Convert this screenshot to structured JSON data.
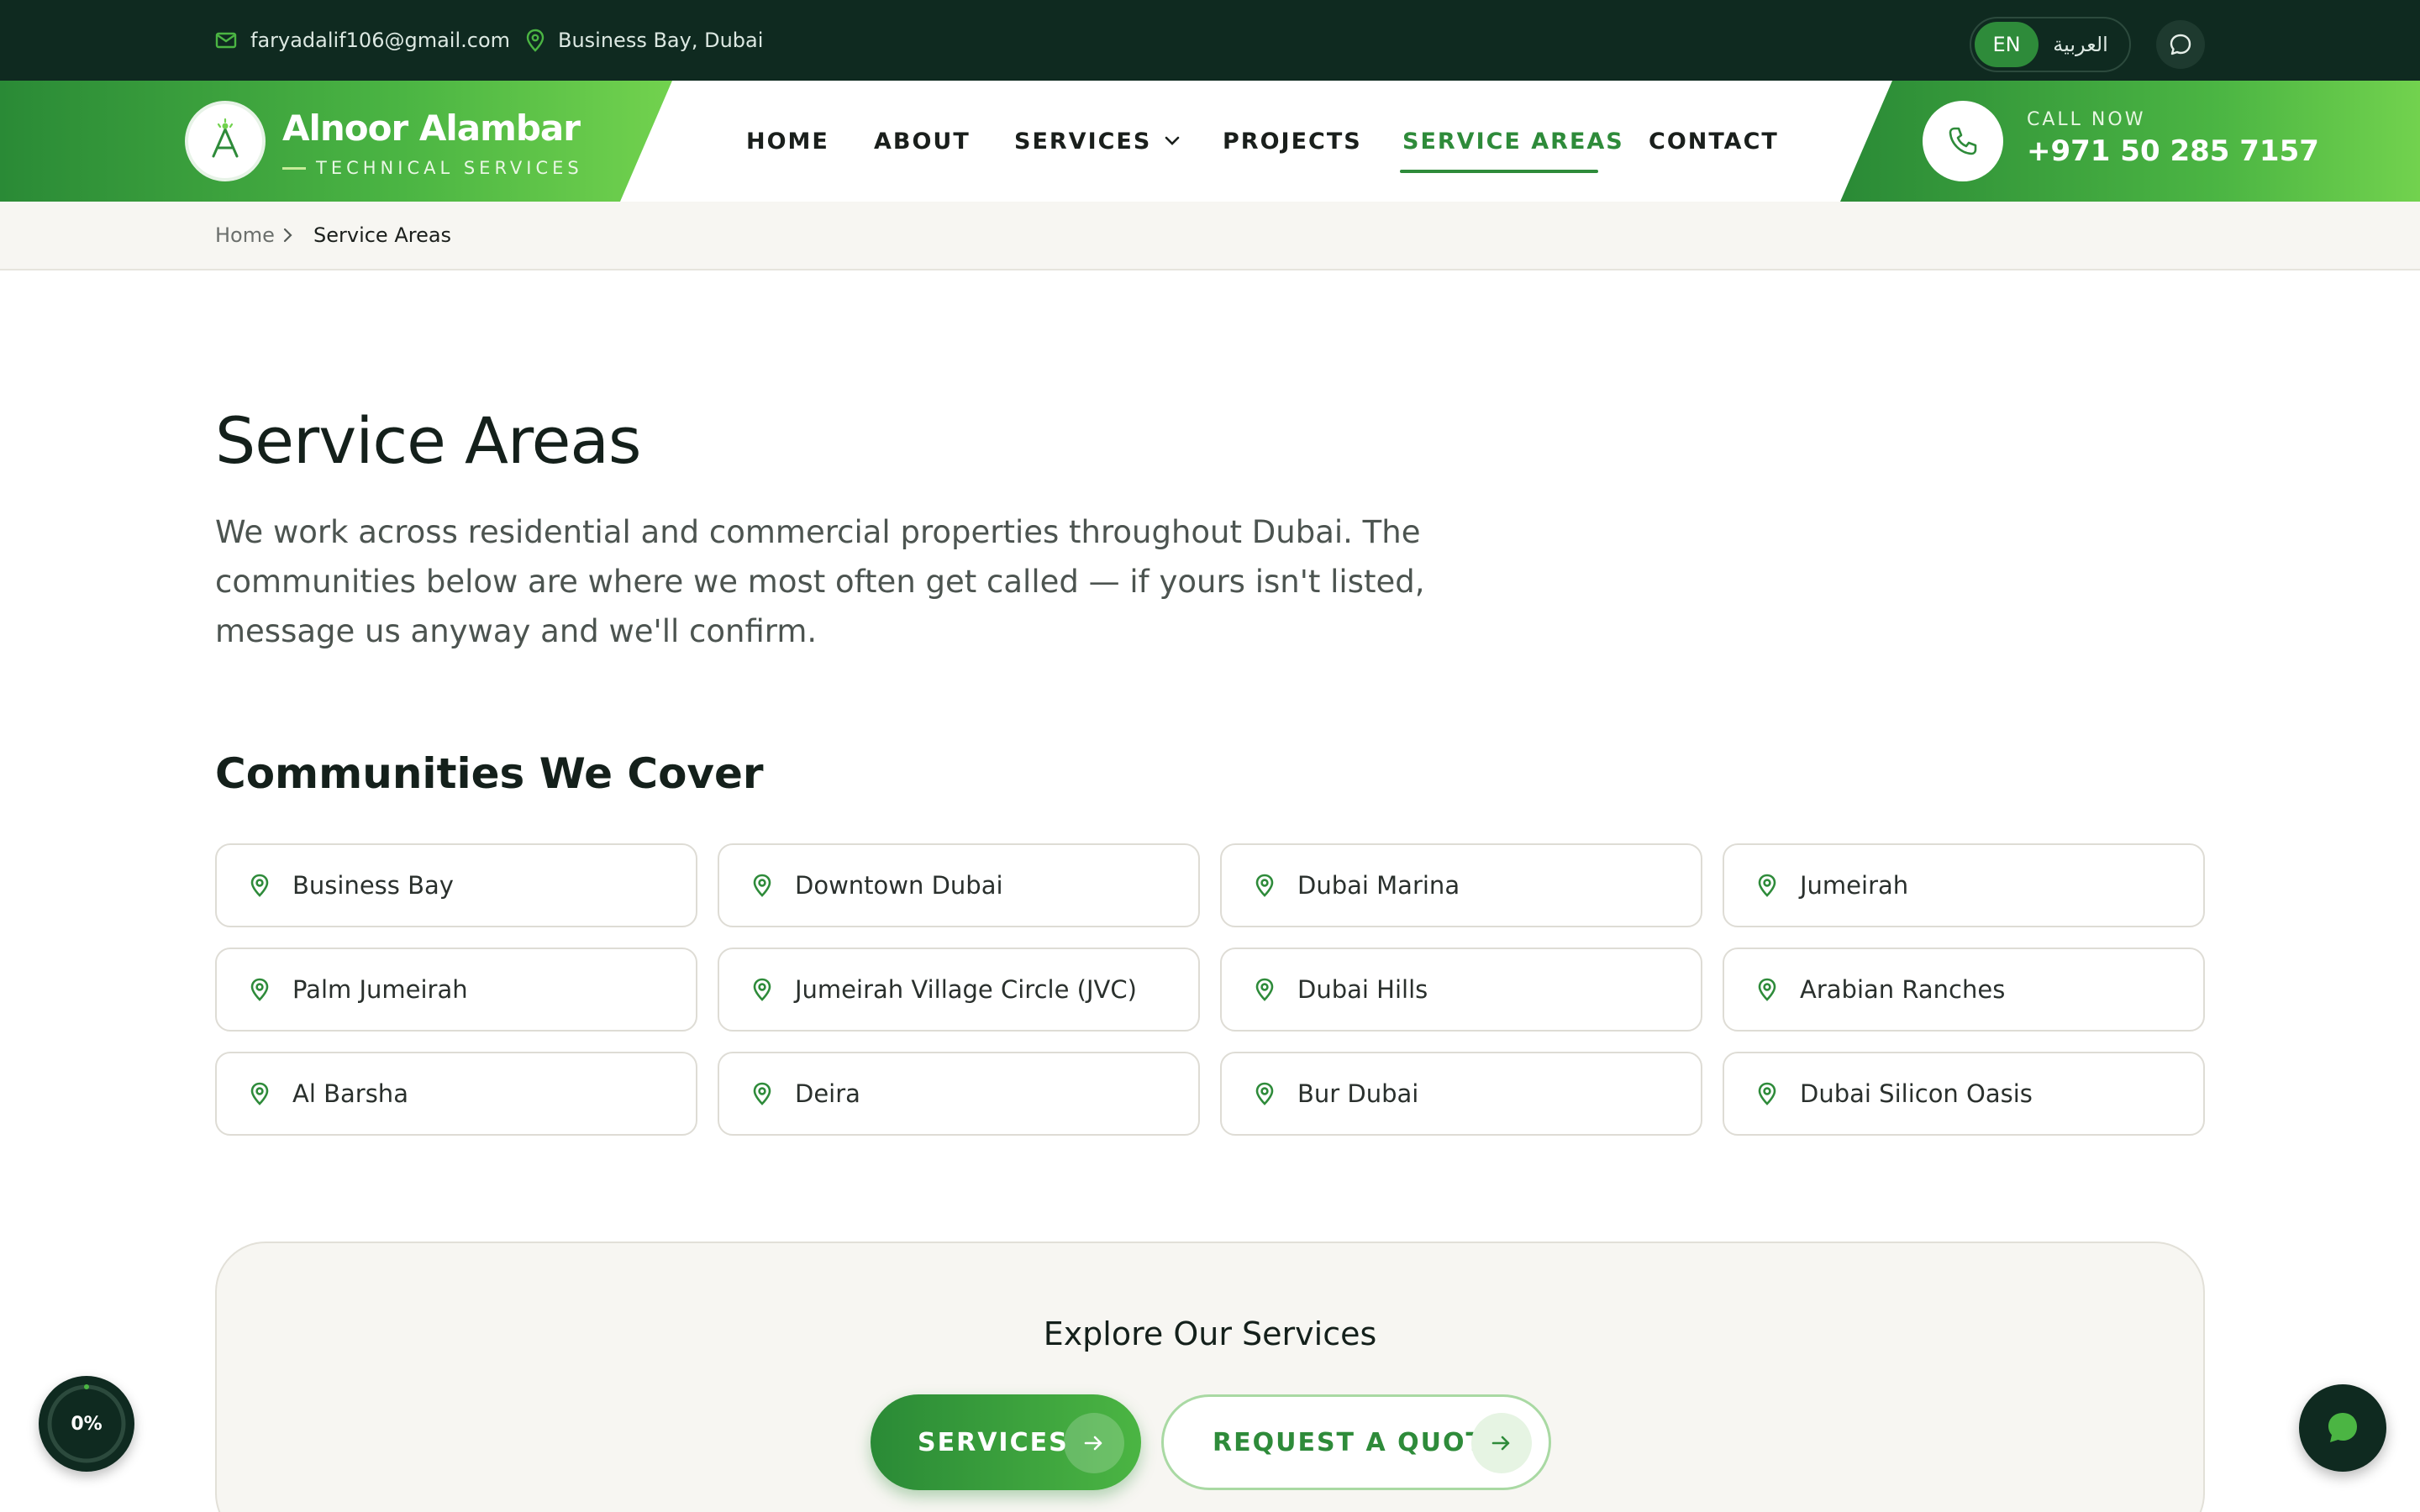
{
  "topbar": {
    "email": "faryadalif106@gmail.com",
    "location": "Business Bay, Dubai",
    "lang_en": "EN",
    "lang_ar": "العربية"
  },
  "brand": {
    "name": "Alnoor Alambar",
    "tagline": "TECHNICAL SERVICES"
  },
  "nav": {
    "items": [
      "HOME",
      "ABOUT",
      "SERVICES",
      "PROJECTS",
      "SERVICE AREAS",
      "CONTACT"
    ],
    "active": "SERVICE AREAS"
  },
  "call": {
    "label": "CALL NOW",
    "number": "+971 50 285 7157"
  },
  "breadcrumb": {
    "home": "Home",
    "current": "Service Areas"
  },
  "main": {
    "title": "Service Areas",
    "intro": "We work across residential and commercial properties throughout Dubai. The communities below are where we most often get called — if yours isn't listed, message us anyway and we'll confirm.",
    "section_title": "Communities We Cover",
    "communities": [
      "Business Bay",
      "Downtown Dubai",
      "Dubai Marina",
      "Jumeirah",
      "Palm Jumeirah",
      "Jumeirah Village Circle (JVC)",
      "Dubai Hills",
      "Arabian Ranches",
      "Al Barsha",
      "Deira",
      "Bur Dubai",
      "Dubai Silicon Oasis"
    ]
  },
  "explore": {
    "title": "Explore Our Services",
    "services_label": "SERVICES",
    "quote_label": "REQUEST A QUOTE"
  },
  "scroll_progress": {
    "label": "0%",
    "value": 0
  },
  "colors": {
    "dark": "#0f2a20",
    "accent": "#2e8b3a",
    "accent_light": "#72d24e",
    "panel": "#f7f6f2"
  }
}
